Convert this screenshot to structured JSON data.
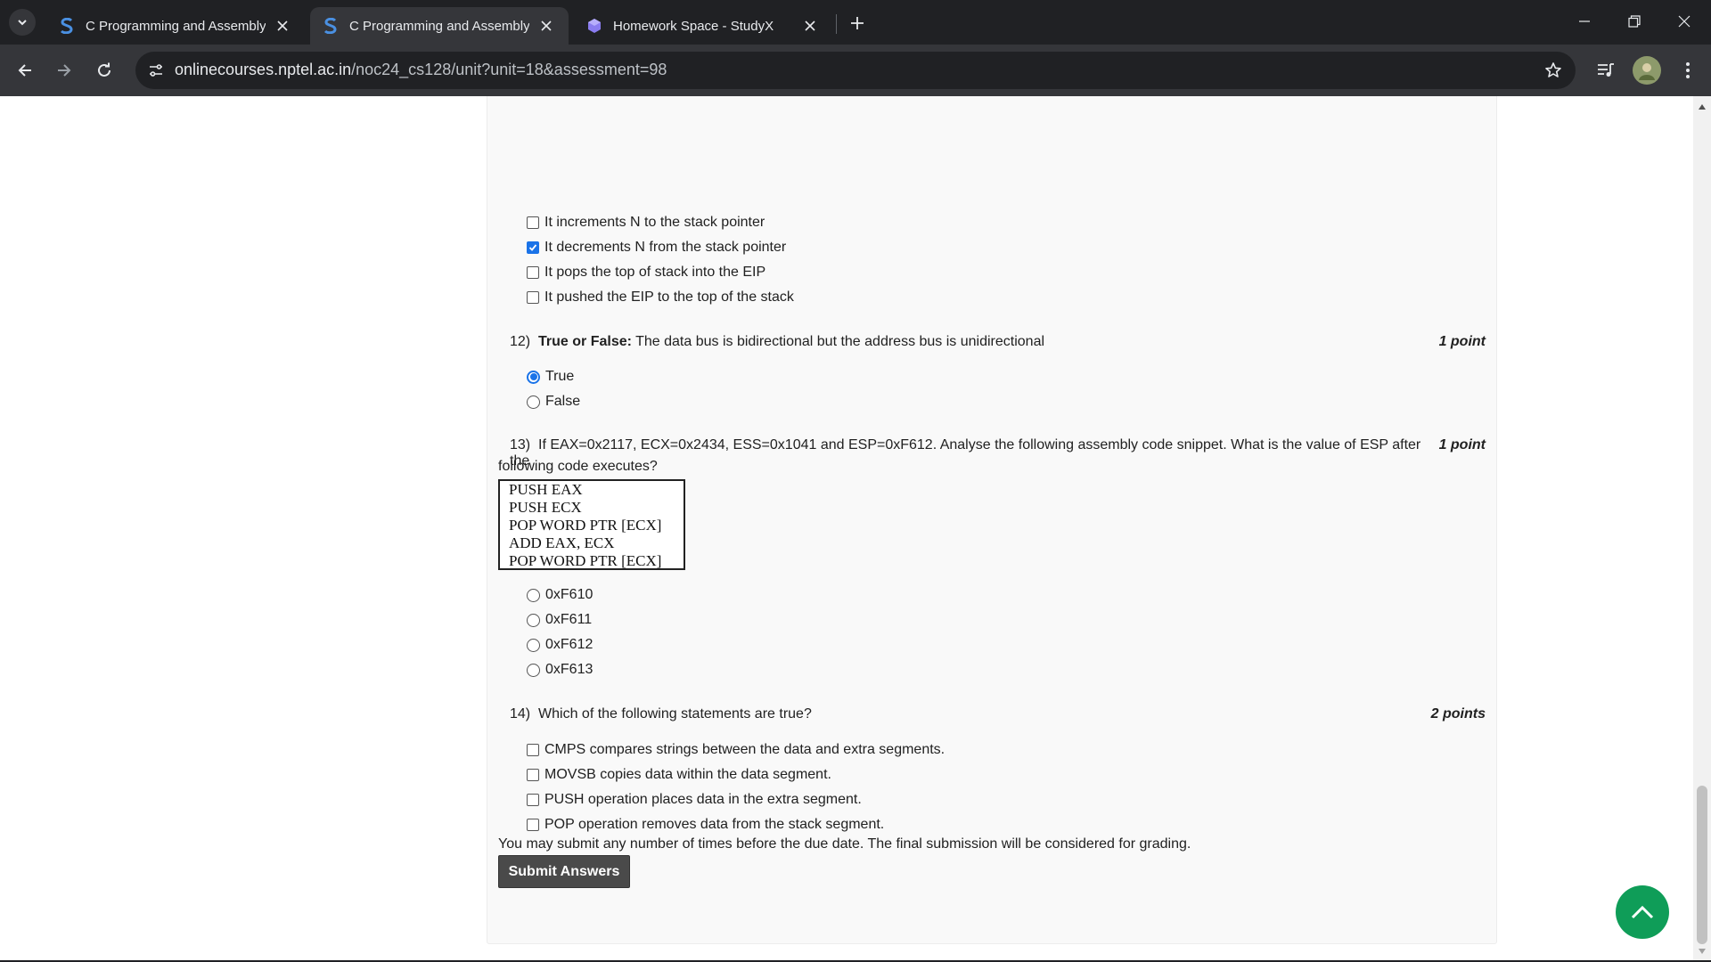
{
  "browser": {
    "tabs": [
      {
        "title": "C Programming and Assembly L",
        "active": false,
        "favicon": "swayam-icon"
      },
      {
        "title": "C Programming and Assembly L",
        "active": true,
        "favicon": "swayam-icon"
      },
      {
        "title": "Homework Space - StudyX",
        "active": false,
        "favicon": "studyx-icon"
      }
    ],
    "url_host": "onlinecourses.nptel.ac.in",
    "url_path": "/noc24_cs128/unit?unit=18&assessment=98"
  },
  "questions": {
    "q11": {
      "options": [
        {
          "label": "It increments N to the stack pointer",
          "checked": false
        },
        {
          "label": "It decrements N from the stack pointer",
          "checked": true
        },
        {
          "label": "It pops the top of stack into the EIP",
          "checked": false
        },
        {
          "label": "It pushed the EIP to the top of the stack",
          "checked": false
        }
      ]
    },
    "q12": {
      "number": "12)",
      "bold_prefix": "True or False:",
      "text": "The data bus is bidirectional but the address bus is unidirectional",
      "points": "1 point",
      "options": [
        {
          "label": "True",
          "checked": true
        },
        {
          "label": "False",
          "checked": false
        }
      ]
    },
    "q13": {
      "number": "13)",
      "text_line1": "If EAX=0x2117, ECX=0x2434, ESS=0x1041 and ESP=0xF612. Analyse the following assembly code snippet. What is the value of ESP after the",
      "text_line2": "following code executes?",
      "points": "1 point",
      "code": [
        "PUSH EAX",
        "PUSH ECX",
        "POP WORD PTR [ECX]",
        "ADD EAX, ECX",
        "POP WORD PTR [ECX]"
      ],
      "options": [
        {
          "label": "0xF610",
          "checked": false
        },
        {
          "label": "0xF611",
          "checked": false
        },
        {
          "label": "0xF612",
          "checked": false
        },
        {
          "label": "0xF613",
          "checked": false
        }
      ]
    },
    "q14": {
      "number": "14)",
      "text": "Which of the following statements are true?",
      "points": "2 points",
      "options": [
        {
          "label": "CMPS compares strings between the data and extra segments.",
          "checked": false
        },
        {
          "label": "MOVSB copies data within the data segment.",
          "checked": false
        },
        {
          "label": "PUSH operation places data in the extra segment.",
          "checked": false
        },
        {
          "label": "POP operation removes data from the stack segment.",
          "checked": false
        }
      ]
    }
  },
  "submit": {
    "note": "You may submit any number of times before the due date. The final submission will be considered for grading.",
    "button_label": "Submit Answers"
  },
  "colors": {
    "accent": "#1a73e8",
    "scroll_top_button": "#0f9d58",
    "submit_button": "#4a4a4a"
  }
}
